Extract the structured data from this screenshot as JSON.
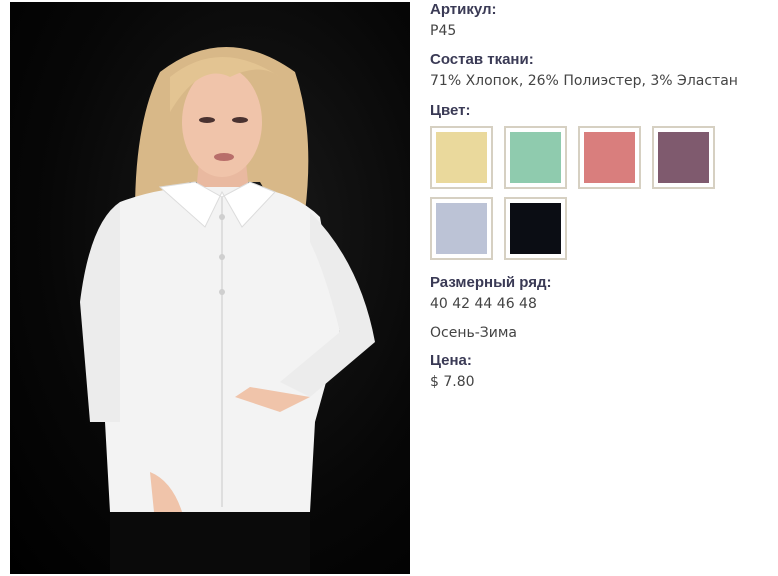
{
  "product": {
    "photo_alt": "Model wearing a white fitted shirt on a black background"
  },
  "details": {
    "article_label": "Артикул:",
    "article_value": "P45",
    "fabric_label": "Состав ткани:",
    "fabric_value": "71% Хлопок, 26% Полиэстер, 3% Эластан",
    "color_label": "Цвет:",
    "colors": [
      {
        "name": "yellow",
        "hex": "#ead99c"
      },
      {
        "name": "mint",
        "hex": "#8fcbae"
      },
      {
        "name": "salmon",
        "hex": "#d97e7d"
      },
      {
        "name": "plum",
        "hex": "#7f5a6e"
      },
      {
        "name": "light-blue",
        "hex": "#bcc3d6"
      },
      {
        "name": "black",
        "hex": "#0b0d14"
      }
    ],
    "size_label": "Размерный ряд:",
    "size_value": "40 42 44 46 48",
    "season_value": "Осень-Зима",
    "price_label": "Цена:",
    "price_value": "$ 7.80"
  }
}
